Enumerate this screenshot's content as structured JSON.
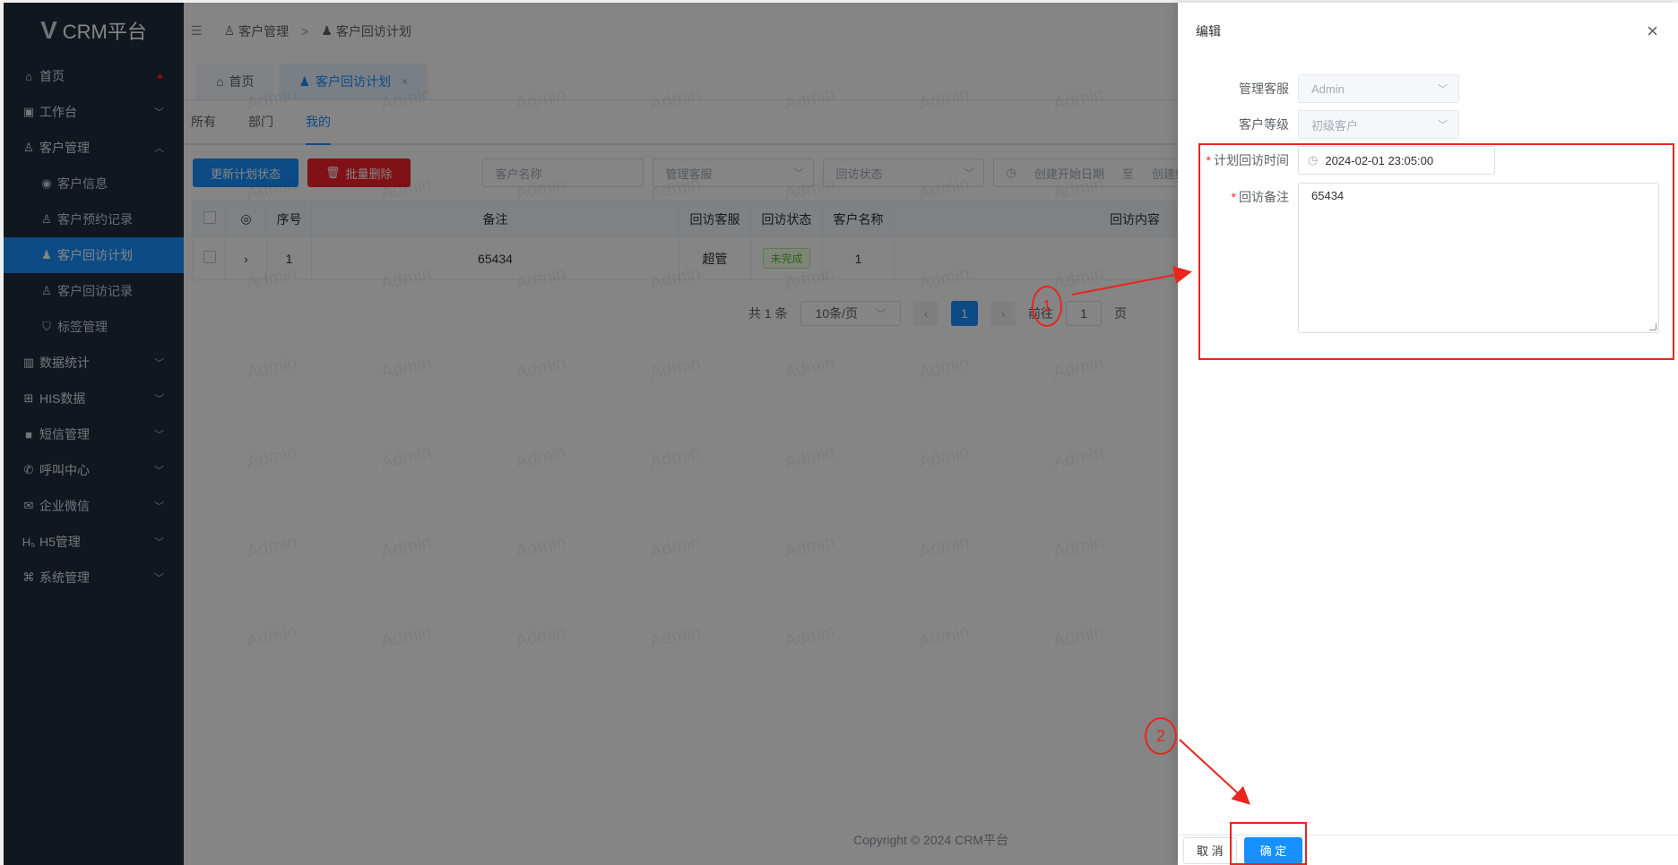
{
  "app": {
    "logo_mark": "V",
    "name": "CRM平台"
  },
  "sidebar": {
    "items": [
      {
        "icon": "⌂",
        "label": "首页",
        "dot": true
      },
      {
        "icon": "▣",
        "label": "工作台",
        "arrow": "﹀"
      },
      {
        "icon": "♙",
        "label": "客户管理",
        "arrow": "︿"
      },
      {
        "icon": "◉",
        "label": "客户信息",
        "sub": true
      },
      {
        "icon": "♙",
        "label": "客户预约记录",
        "sub": true
      },
      {
        "icon": "♟",
        "label": "客户回访计划",
        "sub": true,
        "active": true
      },
      {
        "icon": "♙",
        "label": "客户回访记录",
        "sub": true
      },
      {
        "icon": "⛉",
        "label": "标签管理",
        "sub": true
      },
      {
        "icon": "▥",
        "label": "数据统计",
        "arrow": "﹀"
      },
      {
        "icon": "⊞",
        "label": "HIS数据",
        "arrow": "﹀"
      },
      {
        "icon": "■",
        "label": "短信管理",
        "arrow": "﹀"
      },
      {
        "icon": "✆",
        "label": "呼叫中心",
        "arrow": "﹀"
      },
      {
        "icon": "✉",
        "label": "企业微信",
        "arrow": "﹀"
      },
      {
        "icon": "H₅",
        "label": "H5管理",
        "arrow": "﹀"
      },
      {
        "icon": "⌘",
        "label": "系统管理",
        "arrow": "﹀"
      }
    ]
  },
  "topbar": {
    "fold_icon": "☰",
    "crumbs": [
      "客户管理",
      "客户回访计划"
    ],
    "separator": ">"
  },
  "tabs": [
    {
      "label": "首页"
    },
    {
      "label": "客户回访计划",
      "close": "×"
    }
  ],
  "subtabs": [
    "所有",
    "部门",
    "我的"
  ],
  "toolbar": {
    "update_label": "更新计划状态",
    "delete_label": "批量删除",
    "customer_name_placeholder": "客户名称",
    "manager_placeholder": "管理客服",
    "status_placeholder": "回访状态",
    "start_date_placeholder": "创建开始日期",
    "range_sep": "至",
    "end_date_placeholder": "创建结"
  },
  "table": {
    "headers": [
      "",
      "◎",
      "序号",
      "备注",
      "回访客服",
      "回访状态",
      "客户名称",
      "回访内容"
    ],
    "rows": [
      {
        "expand": "›",
        "index": "1",
        "remark": "65434",
        "agent": "超管",
        "status": "未完成",
        "customer": "1",
        "content": ""
      }
    ]
  },
  "pagination": {
    "total": "共 1 条",
    "page_size": "10条/页",
    "current": "1",
    "goto_prefix": "前往",
    "goto_value": "1",
    "goto_suffix": "页"
  },
  "footer": {
    "copyright": "Copyright © 2024 CRM平台"
  },
  "watermark": "Admin",
  "drawer": {
    "title": "编辑",
    "manager_label": "管理客服",
    "manager_value": "Admin",
    "level_label": "客户等级",
    "level_value": "初级客户",
    "plan_time_label": "计划回访时间",
    "plan_time_value": "2024-02-01 23:05:00",
    "remark_label": "回访备注",
    "remark_value": "65434",
    "cancel_label": "取 消",
    "confirm_label": "确 定"
  },
  "annotations": {
    "step1": "1",
    "step2": "2",
    "color": "#e8261c"
  }
}
